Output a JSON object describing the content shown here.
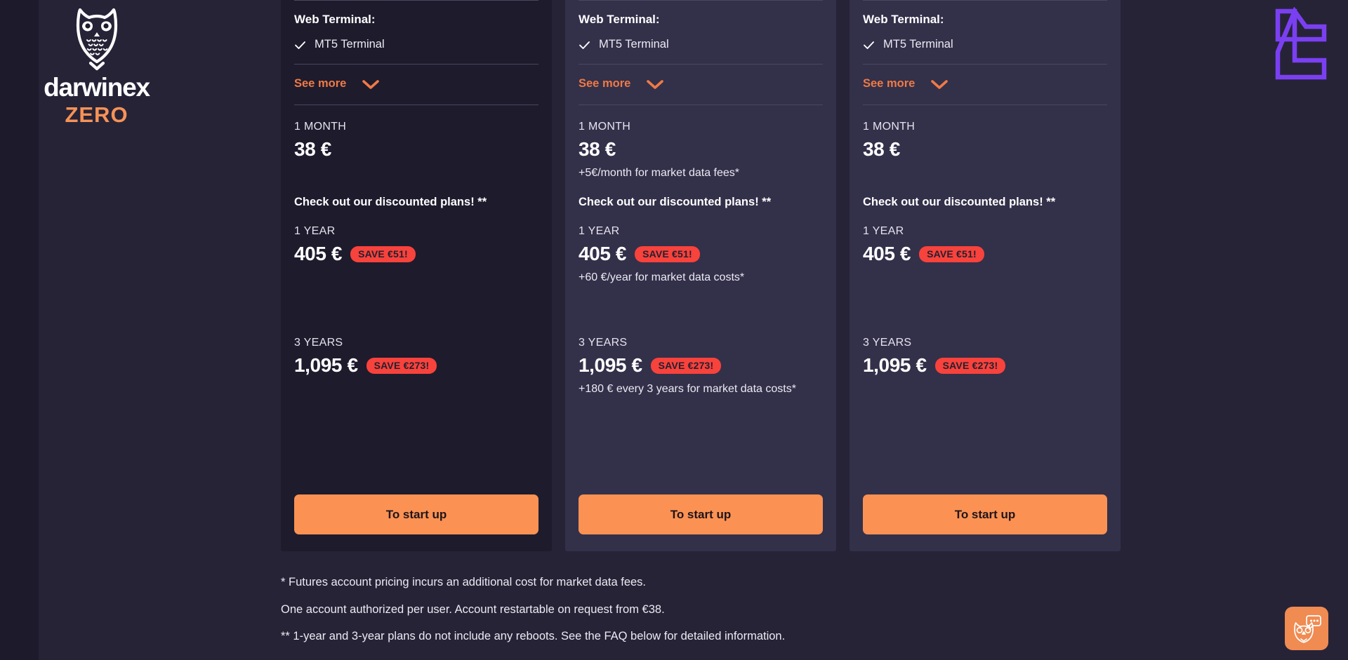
{
  "brand": {
    "logo_icon": "owl-icon",
    "name": "darwinex",
    "sub": "ZERO"
  },
  "corner_logo_icon": "angular-bracket-logo-icon",
  "colors": {
    "page_bg": "#262337",
    "card_dark_bg": "#1e1b2d",
    "card_light_bg": "#33304a",
    "accent_orange": "#ef7a45",
    "cta_orange": "#fb9253",
    "save_red": "#f8423c",
    "brand_sub_orange": "#f79256",
    "corner_purple": "#7b3ff2",
    "divider": "#4a4760"
  },
  "common": {
    "section_title": "Web Terminal:",
    "feature_label": "MT5 Terminal",
    "see_more_label": "See more",
    "promo_title": "Check out our discounted plans! **",
    "cta_label": "To start up",
    "term_month": "1 MONTH",
    "term_year": "1 YEAR",
    "term_3years": "3 YEARS",
    "price_month": "38 €",
    "price_year": "405 €",
    "price_3years": "1,095 €",
    "save_year": "SAVE €51!",
    "save_3years": "SAVE €273!"
  },
  "cards": [
    {
      "id": "card-1",
      "style": "dark",
      "section_title": "Web Terminal:",
      "feature_label": "MT5 Terminal",
      "see_more_label": "See more",
      "promo_title": "Check out our discounted plans! **",
      "cta_label": "To start up",
      "month": {
        "term": "1 MONTH",
        "price": "38 €",
        "fee_note": ""
      },
      "year": {
        "term": "1 YEAR",
        "price": "405 €",
        "save": "SAVE €51!",
        "fee_note": ""
      },
      "threeyears": {
        "term": "3 YEARS",
        "price": "1,095 €",
        "save": "SAVE €273!",
        "fee_note": ""
      }
    },
    {
      "id": "card-2",
      "style": "light",
      "section_title": "Web Terminal:",
      "feature_label": "MT5 Terminal",
      "see_more_label": "See more",
      "promo_title": "Check out our discounted plans! **",
      "cta_label": "To start up",
      "month": {
        "term": "1 MONTH",
        "price": "38 €",
        "fee_note": "+5€/month for market data fees*"
      },
      "year": {
        "term": "1 YEAR",
        "price": "405 €",
        "save": "SAVE €51!",
        "fee_note": "+60 €/year for market data costs*"
      },
      "threeyears": {
        "term": "3 YEARS",
        "price": "1,095 €",
        "save": "SAVE €273!",
        "fee_note": "+180 € every 3 years for market data costs*"
      }
    },
    {
      "id": "card-3",
      "style": "light",
      "section_title": "Web Terminal:",
      "feature_label": "MT5 Terminal",
      "see_more_label": "See more",
      "promo_title": "Check out our discounted plans! **",
      "cta_label": "To start up",
      "month": {
        "term": "1 MONTH",
        "price": "38 €",
        "fee_note": ""
      },
      "year": {
        "term": "1 YEAR",
        "price": "405 €",
        "save": "SAVE €51!",
        "fee_note": ""
      },
      "threeyears": {
        "term": "3 YEARS",
        "price": "1,095 €",
        "save": "SAVE €273!",
        "fee_note": ""
      }
    }
  ],
  "footnotes": [
    "* Futures account pricing incurs an additional cost for market data fees.",
    "One account authorized per user. Account restartable on request from €38.",
    "** 1-year and 3-year plans do not include any reboots. See the FAQ below for detailed information."
  ],
  "chat_widget": {
    "icon": "owl-chat-icon"
  }
}
